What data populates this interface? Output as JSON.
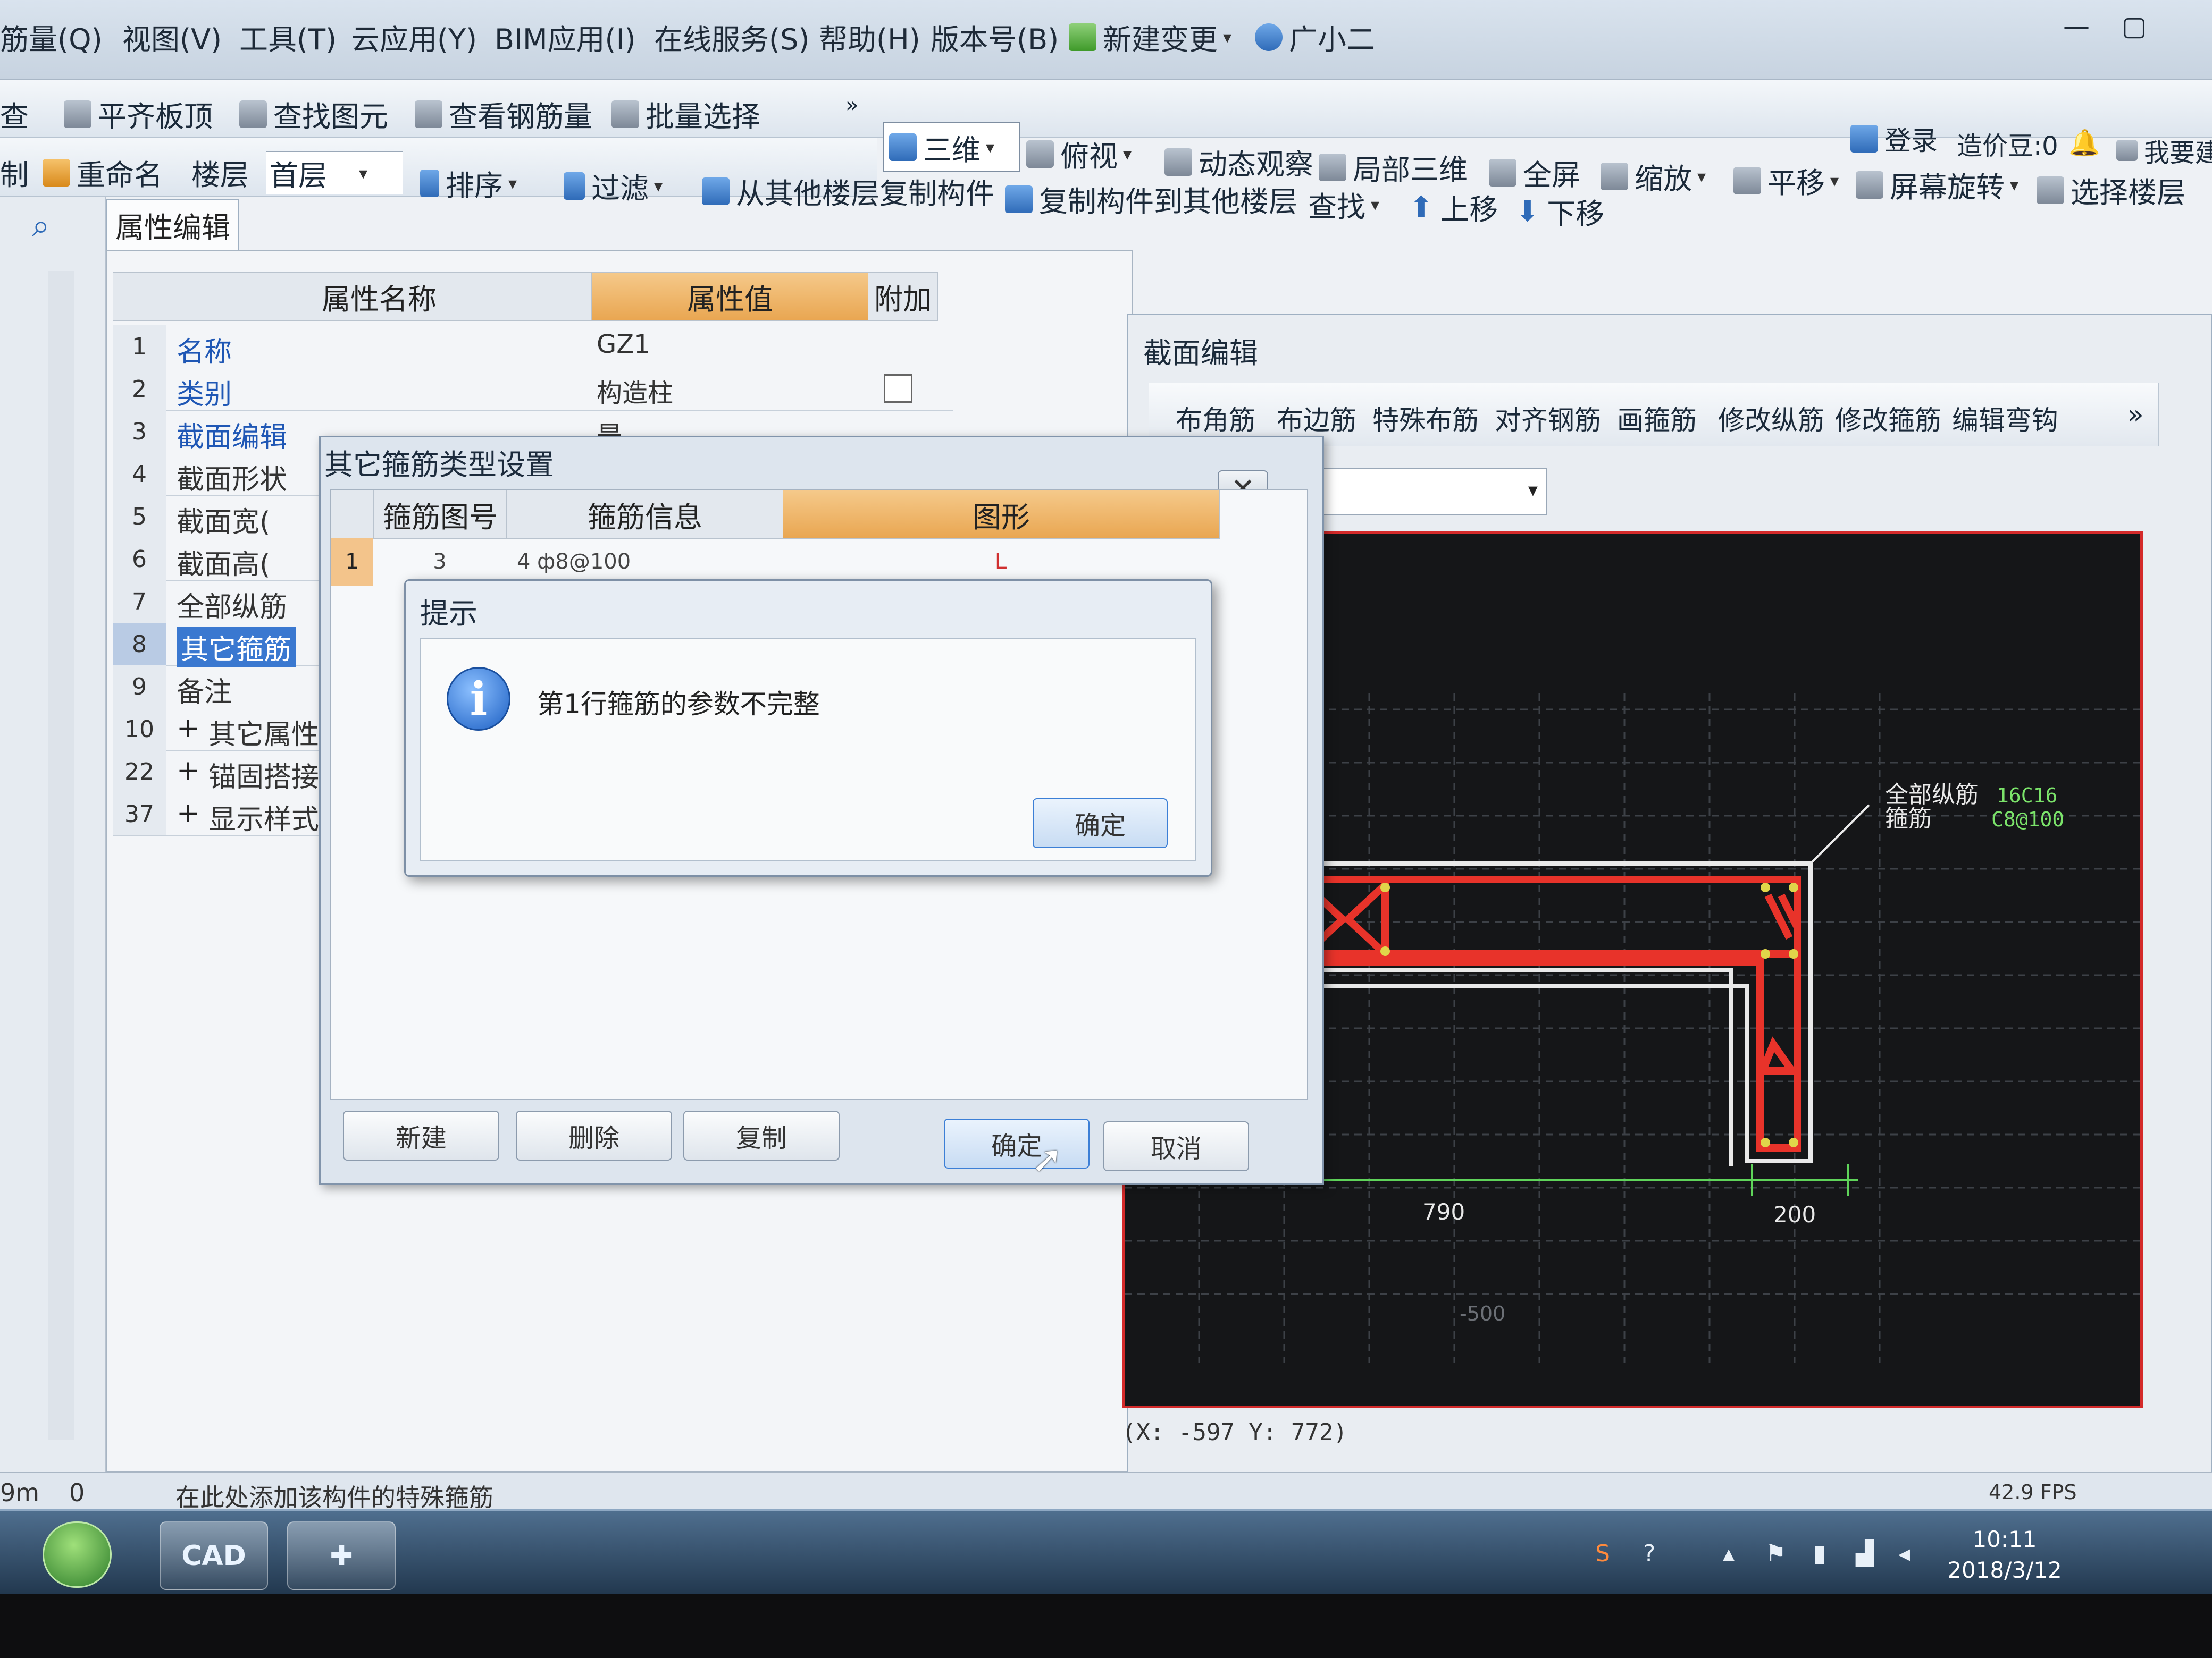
{
  "menu": {
    "items": [
      "筋量(Q)",
      "视图(V)",
      "工具(T)",
      "云应用(Y)",
      "BIM应用(I)",
      "在线服务(S)",
      "帮助(H)",
      "版本号(B)",
      "新建变更",
      "广小二"
    ]
  },
  "toolbar1": {
    "items": [
      "查",
      "平齐板顶",
      "查找图元",
      "查看钢筋量",
      "批量选择"
    ],
    "view_mode": "三维",
    "view_items": [
      "俯视",
      "动态观察",
      "局部三维",
      "全屏",
      "缩放",
      "平移",
      "屏幕旋转",
      "选择楼层"
    ],
    "login": "登录",
    "cost_beans": "造价豆:0",
    "want_build": "我要建"
  },
  "toolbar2": {
    "items": [
      "制",
      "重命名",
      "楼层",
      "首层",
      "排序",
      "过滤",
      "从其他楼层复制构件",
      "复制构件到其他楼层",
      "查找",
      "上移",
      "下移"
    ]
  },
  "prop_panel": {
    "tab": "属性编辑",
    "col_name": "属性名称",
    "col_value": "属性值",
    "col_extra": "附加",
    "rows": [
      {
        "num": "1",
        "name": "名称",
        "value": "GZ1"
      },
      {
        "num": "2",
        "name": "类别",
        "value": "构造柱"
      },
      {
        "num": "3",
        "name": "截面编辑",
        "value": "是"
      },
      {
        "num": "4",
        "name": "截面形状",
        "value": ""
      },
      {
        "num": "5",
        "name": "截面宽(",
        "value": ""
      },
      {
        "num": "6",
        "name": "截面高(",
        "value": ""
      },
      {
        "num": "7",
        "name": "全部纵筋",
        "value": ""
      },
      {
        "num": "8",
        "name": "其它箍筋",
        "value": ""
      },
      {
        "num": "9",
        "name": "备注",
        "value": ""
      },
      {
        "num": "10",
        "name": "其它属性",
        "value": ""
      },
      {
        "num": "22",
        "name": "锚固搭接",
        "value": ""
      },
      {
        "num": "37",
        "name": "显示样式",
        "value": ""
      }
    ]
  },
  "section_editor": {
    "title": "截面编辑",
    "tools": [
      "布角筋",
      "布边筋",
      "特殊布筋",
      "对齐钢筋",
      "画箍筋",
      "修改纵筋",
      "修改箍筋",
      "编辑弯钩"
    ],
    "label_all": "全部纵筋",
    "label_stirrup": "箍筋",
    "value_all": "16C16",
    "value_stirrup": "C8@100",
    "dim_left": "790",
    "dim_right": "200",
    "dim_bottom": "-500",
    "coord": "(X: -597 Y: 772)",
    "fps": "42.9 FPS"
  },
  "dialog_stirrup": {
    "title": "其它箍筋类型设置",
    "col_num": "箍筋图号",
    "col_info": "箍筋信息",
    "col_shape": "图形",
    "row": {
      "idx": "1",
      "num": "3",
      "info": "4 ф8@100",
      "shape": "L"
    },
    "btn_new": "新建",
    "btn_delete": "删除",
    "btn_copy": "复制",
    "btn_ok": "确定",
    "btn_cancel": "取消"
  },
  "message_box": {
    "title": "提示",
    "text": "第1行箍筋的参数不完整",
    "ok": "确定"
  },
  "status": {
    "left": "9m",
    "zero": "0",
    "hint": "在此处添加该构件的特殊箍筋"
  },
  "taskbar": {
    "cad_label": "CAD",
    "time": "10:11",
    "date": "2018/3/12"
  },
  "colors": {
    "rebar": "#e8332a",
    "canvas_bg": "#151618",
    "label_green": "#7be36a",
    "accent_blue": "#3a78d0"
  }
}
